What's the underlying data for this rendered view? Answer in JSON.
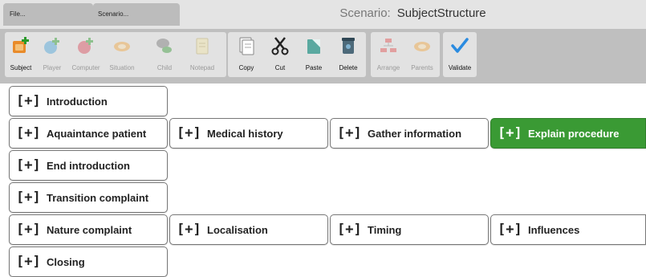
{
  "menu": {
    "file_label": "File...",
    "scenario_label": "Scenario..."
  },
  "title": {
    "prefix": "Scenario:",
    "name": "SubjectStructure"
  },
  "toolbar": {
    "buttons": [
      {
        "label": "Subject",
        "icon": "subject-add-icon",
        "enabled": true
      },
      {
        "label": "Player",
        "icon": "player-add-icon",
        "enabled": false
      },
      {
        "label": "Computer",
        "icon": "computer-add-icon",
        "enabled": false
      },
      {
        "label": "Situation",
        "icon": "situation-icon",
        "enabled": false
      },
      {
        "label": "Child",
        "icon": "child-icon",
        "enabled": false
      },
      {
        "label": "Notepad",
        "icon": "notepad-icon",
        "enabled": false
      },
      {
        "label": "Copy",
        "icon": "copy-icon",
        "enabled": true
      },
      {
        "label": "Cut",
        "icon": "scissors-icon",
        "enabled": true
      },
      {
        "label": "Paste",
        "icon": "paste-icon",
        "enabled": true
      },
      {
        "label": "Delete",
        "icon": "trash-icon",
        "enabled": true
      },
      {
        "label": "Arrange",
        "icon": "arrange-icon",
        "enabled": false
      },
      {
        "label": "Parents",
        "icon": "parents-icon",
        "enabled": false
      },
      {
        "label": "Validate",
        "icon": "checkmark-icon",
        "enabled": true
      }
    ]
  },
  "nodes": {
    "expander": "[+]",
    "items": [
      {
        "label": "Introduction"
      },
      {
        "label": "Aquaintance patient"
      },
      {
        "label": "Medical history"
      },
      {
        "label": "Gather information"
      },
      {
        "label": "Explain procedure",
        "active": true
      },
      {
        "label": "End introduction"
      },
      {
        "label": "Transition complaint"
      },
      {
        "label": "Nature complaint"
      },
      {
        "label": "Localisation"
      },
      {
        "label": "Timing"
      },
      {
        "label": "Influences"
      },
      {
        "label": "Closing"
      }
    ]
  },
  "colors": {
    "active_node": "#3a9a34",
    "toolbar_bg": "#bfbfbf",
    "validate_check": "#2a8be0"
  }
}
